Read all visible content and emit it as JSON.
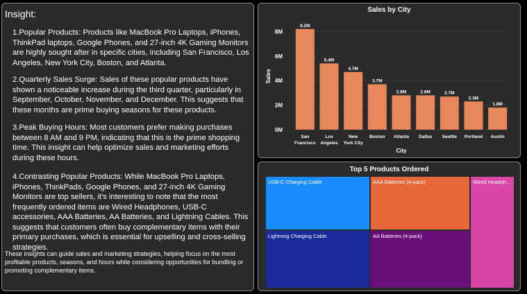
{
  "insight": {
    "title": "Insight:",
    "paragraphs": [
      "1.Popular Products: Products like MacBook Pro Laptops, iPhones, ThinkPad laptops, Google Phones, and 27-inch 4K Gaming Monitors are highly sought after in specific cities, including San Francisco, Los Angeles, New York City, Boston, and Atlanta.",
      "2.Quarterly Sales Surge: Sales of these popular products have shown a noticeable increase during the third quarter, particularly in September, October, November, and December. This suggests that these months are prime buying seasons for these products.",
      "3.Peak Buying Hours: Most customers prefer making purchases between 8 AM and 9 PM, indicating that this is the prime shopping time. This insight can help optimize sales and marketing efforts during these hours.",
      "4.Contrasting Popular Products: While MacBook Pro Laptops, iPhones, ThinkPads, Google Phones, and 27-inch 4K Gaming Monitors are top sellers, it's interesting to note that the most frequently ordered items are Wired Headphones, USB-C accessories, AAA Batteries, AA Batteries, and Lightning Cables. This suggests that customers often buy complementary items with their primary purchases, which is essential for upselling and cross-selling strategies."
    ],
    "footer": "These insights can guide  sales and marketing strategies, helping focus on the most profitable products, seasons, and hours while considering  opportunities for bundling or promoting complementary items."
  },
  "chart_data": [
    {
      "type": "bar",
      "title": "Sales by City",
      "xlabel": "City",
      "ylabel": "Sales",
      "categories": [
        "San Francisco",
        "Los Angeles",
        "New York City",
        "Boston",
        "Atlanta",
        "Dallas",
        "Seattle",
        "Portland",
        "Austin"
      ],
      "category_lines": [
        [
          "San",
          "Francisco"
        ],
        [
          "Los",
          "Angeles"
        ],
        [
          "New",
          "York City"
        ],
        [
          "Boston"
        ],
        [
          "Atlanta"
        ],
        [
          "Dallas"
        ],
        [
          "Seattle"
        ],
        [
          "Portland"
        ],
        [
          "Austin"
        ]
      ],
      "values": [
        8.2,
        5.4,
        4.7,
        3.7,
        2.8,
        2.8,
        2.7,
        2.3,
        1.8
      ],
      "value_labels": [
        "8.2M",
        "5.4M",
        "4.7M",
        "3.7M",
        "2.8M",
        "2.8M",
        "2.7M",
        "2.3M",
        "1.8M"
      ],
      "yticks": [
        0,
        2,
        4,
        6,
        8
      ],
      "ytick_labels": [
        "0M",
        "2M",
        "4M",
        "6M",
        "8M"
      ],
      "ylim": [
        0,
        8.7
      ],
      "grid": true,
      "bar_color": "#e8875a"
    },
    {
      "type": "treemap",
      "title": "Top 5 Products Ordered",
      "items": [
        {
          "label": "USB-C Charging Cable",
          "color": "#1a8cff"
        },
        {
          "label": "AAA Batteries (4-pack)",
          "color": "#e5673a"
        },
        {
          "label": "Wired Headphones",
          "display": "Wired Headph...",
          "color": "#d946a8"
        },
        {
          "label": "Lightning Charging Cable",
          "color": "#1a2c9c"
        },
        {
          "label": "AA Batteries (4-pack)",
          "color": "#6b0f7a"
        }
      ]
    }
  ]
}
